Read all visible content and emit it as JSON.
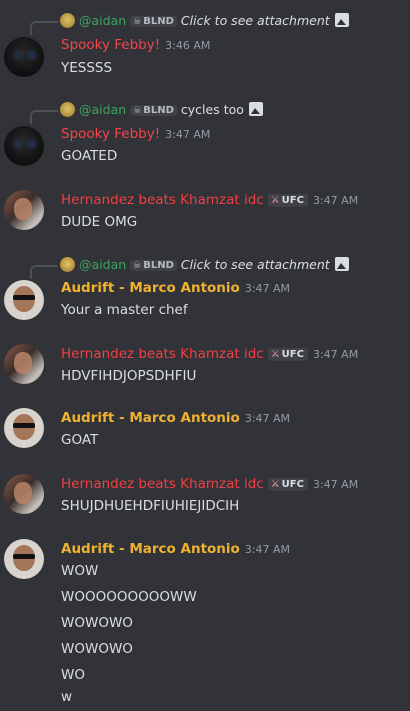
{
  "messages": [
    {
      "reply": {
        "mention": "@aidan",
        "badge": "BLND",
        "text": "Click to see attachment"
      },
      "author": "Spooky Febby!",
      "time": "3:46 AM",
      "lines": [
        "YESSSS"
      ]
    },
    {
      "reply": {
        "mention": "@aidan",
        "badge": "BLND",
        "text": "cycles too"
      },
      "author": "Spooky Febby!",
      "time": "3:47 AM",
      "lines": [
        "GOATED"
      ]
    },
    {
      "author": "Hernandez beats Khamzat idc",
      "tag": "UFC",
      "time": "3:47 AM",
      "lines": [
        "DUDE OMG"
      ]
    },
    {
      "reply": {
        "mention": "@aidan",
        "badge": "BLND",
        "text": "Click to see attachment"
      },
      "author": "Audrift - Marco Antonio",
      "time": "3:47 AM",
      "lines": [
        "Your a master chef"
      ]
    },
    {
      "author": "Hernandez beats Khamzat idc",
      "tag": "UFC",
      "time": "3:47 AM",
      "lines": [
        "HDVFIHDJOPSDHFIU"
      ]
    },
    {
      "author": "Audrift - Marco Antonio",
      "time": "3:47 AM",
      "lines": [
        "GOAT"
      ]
    },
    {
      "author": "Hernandez beats Khamzat idc",
      "tag": "UFC",
      "time": "3:47 AM",
      "lines": [
        "SHUJDHUEHDFIUHIEJIDCIH"
      ]
    },
    {
      "author": "Audrift - Marco Antonio",
      "time": "3:47 AM",
      "lines": [
        "WOW",
        "WOOOOOOOOOWW",
        "WOWOWO",
        "WOWOWO",
        "WO",
        "w"
      ]
    }
  ],
  "colors": {
    "febby": "#f0474a",
    "hernandez": "#f23f43",
    "audrift": "#f0b232",
    "mention": "#3ba55d"
  },
  "icons": {
    "reply_avatar": "aidan-avatar",
    "attachment": "image-icon",
    "badge": "skull-icon",
    "tag": "sword-icon"
  }
}
